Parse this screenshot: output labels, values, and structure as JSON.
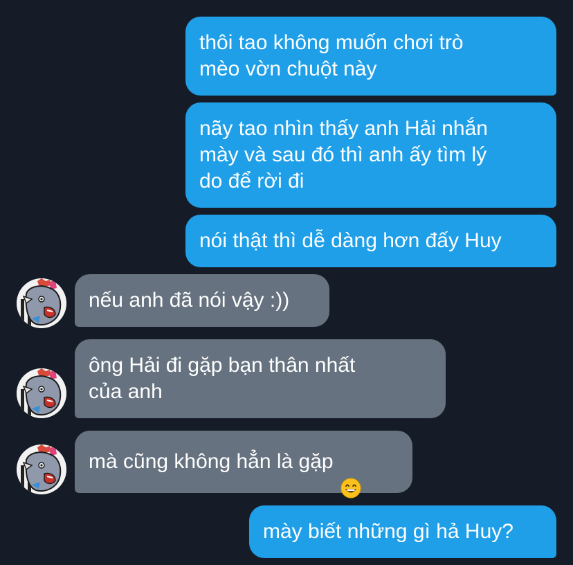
{
  "messages": [
    {
      "sender": "me",
      "text": "thôi tao không muốn chơi trò\nmèo vờn chuột này"
    },
    {
      "sender": "me",
      "text": "nãy tao nhìn thấy anh Hải nhắn\nmày và sau đó thì anh ấy tìm lý\ndo để rời đi"
    },
    {
      "sender": "me",
      "text": "nói thật thì dễ dàng hơn đấy Huy"
    },
    {
      "sender": "them",
      "text": "nếu anh đã nói vậy :))"
    },
    {
      "sender": "them",
      "text": "ông Hải đi gặp bạn thân nhất\ncủa anh"
    },
    {
      "sender": "them",
      "text": "mà cũng không hẳn là gặp",
      "emoji": "grinning-face-with-smiling-eyes"
    },
    {
      "sender": "me",
      "text": "mày biết những gì hả Huy?"
    }
  ],
  "colors": {
    "background": "#151c27",
    "outgoing_bubble": "#1f9fe8",
    "incoming_bubble": "#66727f",
    "text": "#ffffff"
  },
  "icons": {
    "avatar": "rhino-cartoon-avatar",
    "emoji": "grinning-face-with-smiling-eyes"
  }
}
